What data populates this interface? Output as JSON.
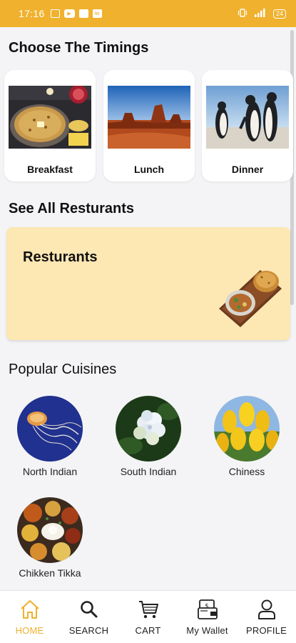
{
  "status_bar": {
    "time": "17:16",
    "battery": "24"
  },
  "sections": {
    "timings_title": "Choose The Timings",
    "restaurants_title": "See All Resturants",
    "cuisines_title": "Popular Cuisines"
  },
  "timings": [
    {
      "label": "Breakfast"
    },
    {
      "label": "Lunch"
    },
    {
      "label": "Dinner"
    }
  ],
  "restaurants_banner": {
    "title": "Resturants"
  },
  "cuisines": [
    {
      "label": "North Indian"
    },
    {
      "label": "South Indian"
    },
    {
      "label": "Chiness"
    },
    {
      "label": "Chikken Tikka"
    }
  ],
  "bottom_nav": [
    {
      "label": "HOME",
      "icon": "home-icon",
      "active": true
    },
    {
      "label": "SEARCH",
      "icon": "search-icon"
    },
    {
      "label": "CART",
      "icon": "cart-icon"
    },
    {
      "label": "My Wallet",
      "icon": "wallet-icon"
    },
    {
      "label": "PROFILE",
      "icon": "profile-icon"
    }
  ],
  "colors": {
    "accent": "#f0b12e",
    "banner": "#fde7b2"
  }
}
